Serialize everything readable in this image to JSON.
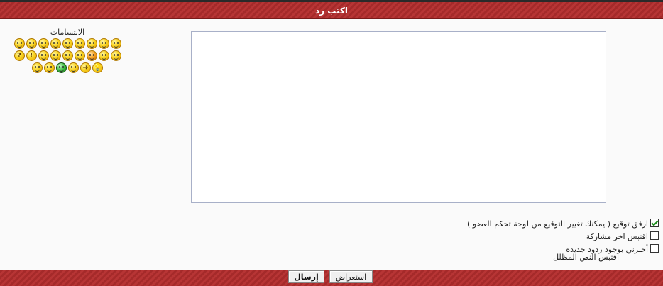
{
  "header": {
    "title": "اكتب رد"
  },
  "smilies": {
    "title": "الابتسامات",
    "items": [
      {
        "name": "big-grin",
        "style": "face"
      },
      {
        "name": "cool",
        "style": "face"
      },
      {
        "name": "confused",
        "style": "face"
      },
      {
        "name": "eek",
        "style": "face"
      },
      {
        "name": "surprised",
        "style": "face"
      },
      {
        "name": "rolleyes",
        "style": "face"
      },
      {
        "name": "wink",
        "style": "face"
      },
      {
        "name": "smile",
        "style": "face"
      },
      {
        "name": "laugh",
        "style": "face"
      },
      {
        "name": "question",
        "style": "glyph",
        "glyph": "?"
      },
      {
        "name": "exclaim",
        "style": "glyph",
        "glyph": "!"
      },
      {
        "name": "smirk",
        "style": "face"
      },
      {
        "name": "evil",
        "style": "face"
      },
      {
        "name": "mad",
        "style": "face"
      },
      {
        "name": "sleepy",
        "style": "face"
      },
      {
        "name": "blush",
        "style": "orange"
      },
      {
        "name": "tongue",
        "style": "face"
      },
      {
        "name": "lol",
        "style": "face"
      },
      {
        "name": "nerd",
        "style": "face"
      },
      {
        "name": "glasses",
        "style": "face"
      },
      {
        "name": "green-grin",
        "style": "green"
      },
      {
        "name": "neutral",
        "style": "face"
      },
      {
        "name": "arrow",
        "style": "glyph",
        "glyph": "➜"
      },
      {
        "name": "idea",
        "style": "glyph",
        "glyph": "💡"
      }
    ]
  },
  "editor": {
    "value": ""
  },
  "options": [
    {
      "label": "ارفق توقيع ( يمكنك تغيير التوقيع من لوحة تحكم العضو )",
      "checked": true
    },
    {
      "label": "اقتبس اخر مشاركة",
      "checked": false
    },
    {
      "label": "أخبرني بوجود ردود جديدة",
      "checked": false
    }
  ],
  "quote_selected_label": "اقتبس النص المظلل",
  "buttons": {
    "preview": "استعراض",
    "send": "إرسال"
  }
}
